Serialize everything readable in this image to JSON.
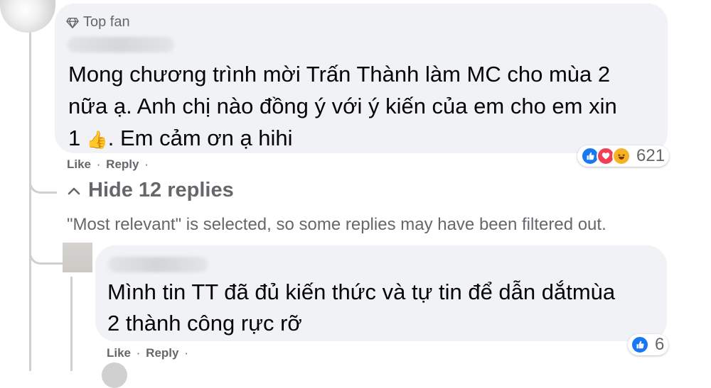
{
  "comment": {
    "badge_label": "Top fan",
    "badge_icon": "diamond-icon",
    "text_line1": "Mong chương trình mời Trấn Thành làm MC cho mùa 2",
    "text_line2": "nữa ạ. Anh chị nào đồng ý với ý kiến của em cho em xin",
    "text_line3_pre": "1 ",
    "text_line3_emoji": "👍",
    "text_line3_post": ". Em cảm ơn ạ hihi",
    "like_label": "Like",
    "reply_label": "Reply",
    "separator": "·",
    "reaction_count": "621",
    "reaction_icons": [
      "like-icon",
      "love-icon",
      "haha-icon"
    ]
  },
  "replies_toggle": {
    "label": "Hide 12 replies",
    "icon": "chevron-up-icon"
  },
  "filter_note": "\"Most relevant\" is selected, so some replies may have been filtered out.",
  "reply": {
    "text_line1": "Mình tin TT đã đủ kiến thức và tự tin để dẫn dắtmùa",
    "text_line2": "2 thành công rực rỡ",
    "like_label": "Like",
    "reply_label": "Reply",
    "separator": "·",
    "reaction_count": "6",
    "reaction_icons": [
      "like-icon"
    ]
  },
  "colors": {
    "bubble_bg": "#f0f2f5",
    "secondary_text": "#65676b",
    "primary_text": "#050505",
    "like_blue": "#1877f2",
    "love_red": "#f33e58",
    "haha_yellow": "#f7b125"
  }
}
